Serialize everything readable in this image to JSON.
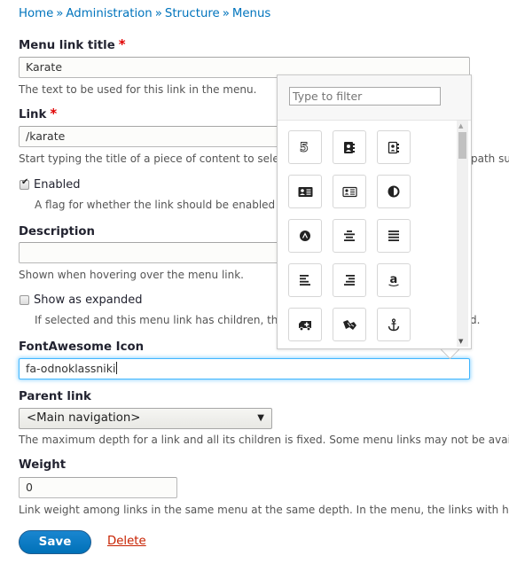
{
  "breadcrumb": {
    "items": [
      "Home",
      "Administration",
      "Structure",
      "Menus"
    ],
    "separator": "»"
  },
  "form": {
    "title": {
      "label": "Menu link title",
      "required_marker": "*",
      "value": "Karate",
      "description": "The text to be used for this link in the menu."
    },
    "link": {
      "label": "Link",
      "required_marker": "*",
      "value": "/karate",
      "description": "Start typing the title of a piece of content to sele",
      "description_tail": "path suc"
    },
    "enabled": {
      "label": "Enabled",
      "checked": true,
      "description": "A flag for whether the link should be enabled"
    },
    "description": {
      "label": "Description",
      "value": "",
      "description": "Shown when hovering over the menu link."
    },
    "expanded": {
      "label": "Show as expanded",
      "checked": false,
      "description": "If selected and this menu link has children, th",
      "description_tail": "d."
    },
    "icon": {
      "label": "FontAwesome Icon",
      "value": "fa-odnoklassniki"
    },
    "parent": {
      "label": "Parent link",
      "selected": "<Main navigation>",
      "description": "The maximum depth for a link and all its children is fixed. Some menu links may not be avai"
    },
    "weight": {
      "label": "Weight",
      "value": "0",
      "description": "Link weight among links in the same menu at the same depth. In the menu, the links with h"
    },
    "actions": {
      "save_label": "Save",
      "delete_label": "Delete"
    }
  },
  "icon_picker": {
    "filter_placeholder": "Type to filter",
    "icons": [
      "fa-500px",
      "fa-address-book",
      "fa-address-book-o",
      "fa-address-card",
      "fa-address-card-o",
      "fa-adjust",
      "fa-adn",
      "fa-align-center",
      "fa-align-justify",
      "fa-align-left",
      "fa-align-right",
      "fa-amazon",
      "fa-ambulance",
      "fa-american-sign-language-interpreting",
      "fa-anchor"
    ]
  },
  "colors": {
    "link": "#0074bd",
    "required": "#e00000",
    "primary_button": "#0071b8",
    "danger_link": "#c72100",
    "focus_ring": "#40b6ff"
  }
}
